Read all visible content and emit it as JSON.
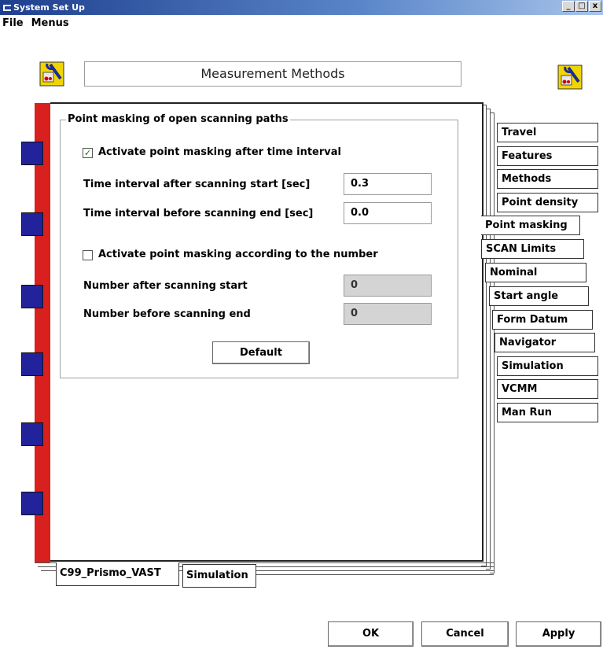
{
  "window": {
    "title": "System Set Up",
    "controls": [
      "_",
      "□",
      "x"
    ]
  },
  "menubar": {
    "items": [
      "File",
      "Menus"
    ]
  },
  "header": {
    "title": "Measurement Methods",
    "icon": "tools-icon"
  },
  "group": {
    "legend": "Point masking of open scanning paths",
    "time_checkbox": {
      "label": "Activate point masking after time interval",
      "checked": true
    },
    "time_start": {
      "label": "Time interval after scanning start [sec]",
      "value": "0.3"
    },
    "time_end": {
      "label": "Time interval before scanning end [sec]",
      "value": "0.0"
    },
    "number_checkbox": {
      "label": "Activate point masking according to the number",
      "checked": false
    },
    "number_start": {
      "label": "Number after scanning start",
      "value": "0"
    },
    "number_end": {
      "label": "Number before scanning end",
      "value": "0"
    },
    "default_button": "Default"
  },
  "side_tabs": [
    "Travel",
    "Features",
    "Methods",
    "Point density",
    "Point masking",
    "SCAN Limits",
    "Nominal",
    "Start angle",
    "Form Datum",
    "Navigator",
    "Simulation",
    "VCMM",
    "Man Run"
  ],
  "active_side_tab": "Point masking",
  "bottom_tabs": [
    "C99_Prismo_VAST",
    "Simulation"
  ],
  "footer": {
    "ok": "OK",
    "cancel": "Cancel",
    "apply": "Apply"
  },
  "colors": {
    "spine": "#d8201f",
    "spine_tabs": "#22229a",
    "titlebar": "#1e3f8e"
  }
}
